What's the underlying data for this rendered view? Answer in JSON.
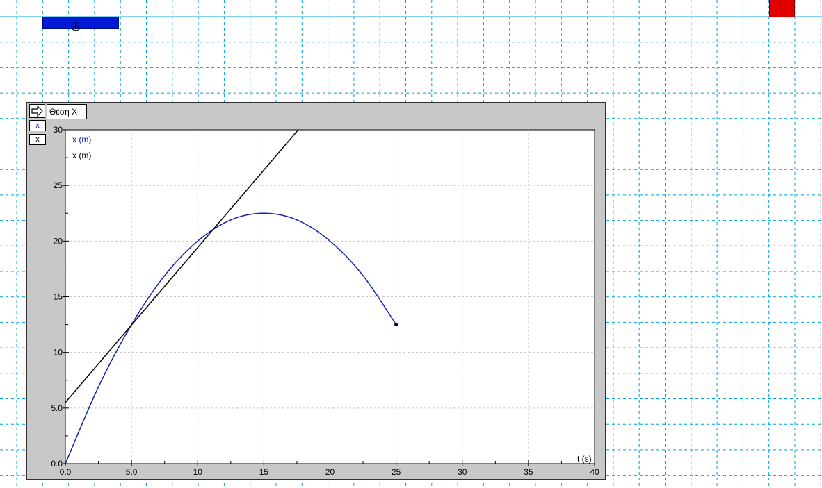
{
  "graph": {
    "title": "Θέση X",
    "series_buttons": [
      "x",
      "x"
    ],
    "legend": [
      "x (m)",
      "x (m)"
    ]
  },
  "colors": {
    "background_grid": "#00a0e0",
    "plot_gridlines": "#c8c8c8",
    "curve": "#1020b0",
    "tangent": "#000000",
    "window": "#c8c8c8"
  },
  "icons": {
    "arrow": "right-arrow-icon",
    "anchor": "anchor-icon"
  },
  "chart_data": {
    "type": "line",
    "xlabel": "t (s)",
    "ylabel": "",
    "xlim": [
      0,
      40
    ],
    "ylim": [
      0,
      30
    ],
    "x_ticks": [
      0,
      5,
      10,
      15,
      20,
      25,
      30,
      35,
      40
    ],
    "x_tick_labels": [
      "0.0",
      "5.0",
      "10",
      "15",
      "20",
      "25",
      "30",
      "35",
      "40"
    ],
    "y_ticks": [
      0,
      5,
      10,
      15,
      20,
      25,
      30
    ],
    "y_tick_labels": [
      "0.0",
      "5.0",
      "10",
      "15",
      "20",
      "25",
      "30"
    ],
    "grid": true,
    "legend_position": "top-left",
    "series": [
      {
        "name": "x (m)",
        "color": "#1020b0",
        "x": [
          0,
          2.5,
          5,
          7.5,
          10,
          12.5,
          15,
          17.5,
          20,
          22.5,
          25
        ],
        "y": [
          0,
          6.9,
          12.5,
          16.9,
          20,
          21.9,
          22.5,
          21.9,
          20,
          16.9,
          12.5
        ]
      },
      {
        "name": "x (m)",
        "color": "#000000",
        "x": [
          0,
          17.6
        ],
        "y": [
          5.5,
          30
        ]
      }
    ],
    "endpoint": {
      "x": 25,
      "y": 12.5
    }
  }
}
